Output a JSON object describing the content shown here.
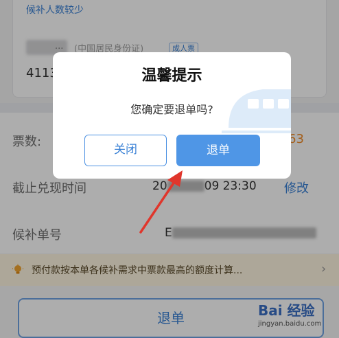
{
  "background": {
    "hint_link": "候补人数较少",
    "passenger": {
      "name_tail": "...",
      "id_type": "(中国居民身份证)",
      "badge": "成人票",
      "id_number_prefix": "4113"
    },
    "rows": [
      {
        "label": "票数:",
        "value": ""
      },
      {
        "label": "截止兑现时间",
        "value_prefix": "20",
        "value_suffix": "09 23:30",
        "action": "修改"
      },
      {
        "label": "候补单号",
        "value_prefix": "E"
      }
    ],
    "price_fragment": "63",
    "notice": {
      "text": "预付款按本单各候补需求中票款最高的额度计算...",
      "icon": "lightbulb-icon"
    },
    "bottom_button": "退单"
  },
  "dialog": {
    "title": "温馨提示",
    "message": "您确定要退单吗?",
    "close_label": "关闭",
    "refund_label": "退单"
  },
  "watermark": {
    "logo": "Bai 经验",
    "sub": "jingyan.baidu.com"
  },
  "colors": {
    "accent": "#4f96e6",
    "link": "#3b82d6",
    "arrow": "#e0362c",
    "notice_bg": "#fff6e2"
  }
}
